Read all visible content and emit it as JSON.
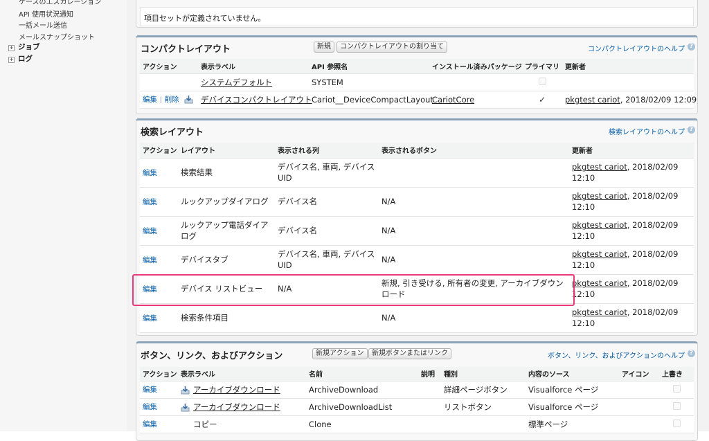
{
  "sidebar": {
    "items_top": [
      "ケースのエスカレーション",
      "API 使用状況通知",
      "一括メール送信",
      "メールスナップショット"
    ],
    "groups": [
      "ジョブ",
      "ログ"
    ],
    "toggle_glyph": "+"
  },
  "top_box": {
    "message": "項目セットが定義されていません。"
  },
  "compact": {
    "title": "コンパクトレイアウト",
    "btn_new": "新規",
    "btn_assign": "コンパクトレイアウトの割り当て",
    "help": "コンパクトレイアウトのヘルプ",
    "headers": [
      "アクション",
      "表示ラベル",
      "API 参照名",
      "インストール済みパッケージ",
      "プライマリ",
      "更新者"
    ],
    "rows": [
      {
        "action_edit": "",
        "action_sep": "",
        "action_delete": "",
        "label": "システムデフォルト",
        "api": "SYSTEM",
        "package": "",
        "primary": false,
        "modified_user": "",
        "modified_date": ""
      },
      {
        "action_edit": "編集",
        "action_sep": "|",
        "action_delete": "削除",
        "label": "デバイスコンパクトレイアウト",
        "api": "Cariot__DeviceCompactLayout",
        "package": "CariotCore",
        "primary": true,
        "check_glyph": "✓",
        "modified_user": "pkgtest cariot",
        "modified_date": ", 2018/02/09 12:09"
      }
    ]
  },
  "search": {
    "title": "検索レイアウト",
    "help": "検索レイアウトのヘルプ",
    "headers": [
      "アクション",
      "レイアウト",
      "表示される列",
      "表示されるボタン",
      "更新者"
    ],
    "rows": [
      {
        "action": "編集",
        "layout": "検索結果",
        "columns": "デバイス名, 車両, デバイスUID",
        "buttons": "",
        "modified_user": "pkgtest cariot",
        "modified_date": ", 2018/02/09 12:10"
      },
      {
        "action": "編集",
        "layout": "ルックアップダイアログ",
        "columns": "デバイス名",
        "buttons": "N/A",
        "modified_user": "pkgtest cariot",
        "modified_date": ", 2018/02/09 12:10"
      },
      {
        "action": "編集",
        "layout": "ルックアップ電話ダイアログ",
        "columns": "デバイス名",
        "buttons": "N/A",
        "modified_user": "pkgtest cariot",
        "modified_date": ", 2018/02/09 12:10"
      },
      {
        "action": "編集",
        "layout": "デバイスタブ",
        "columns": "デバイス名, 車両, デバイスUID",
        "buttons": "N/A",
        "modified_user": "pkgtest cariot",
        "modified_date": ", 2018/02/09 12:10"
      },
      {
        "action": "編集",
        "layout": "デバイス リストビュー",
        "columns": "N/A",
        "buttons": "新規, 引き受ける, 所有者の変更, アーカイブダウンロード",
        "modified_user": "pkgtest cariot",
        "modified_date": ", 2018/02/09 12:10"
      },
      {
        "action": "編集",
        "layout": "検索条件項目",
        "columns": "",
        "buttons": "N/A",
        "modified_user": "pkgtest cariot",
        "modified_date": ", 2018/02/09 12:10"
      }
    ]
  },
  "buttons_section": {
    "title": "ボタン、リンク、およびアクション",
    "btn_new_action": "新規アクション",
    "btn_new_button": "新規ボタンまたはリンク",
    "help": "ボタン、リンク、およびアクションのヘルプ",
    "headers": [
      "アクション",
      "表示ラベル",
      "名前",
      "説明",
      "種別",
      "内容のソース",
      "アイコン",
      "上書き"
    ],
    "rows": [
      {
        "action": "編集",
        "label": "アーカイブダウンロード",
        "has_icon": true,
        "name": "ArchiveDownload",
        "desc": "",
        "type": "詳細ページボタン",
        "source": "Visualforce ページ"
      },
      {
        "action": "編集",
        "label": "アーカイブダウンロード",
        "has_icon": true,
        "name": "ArchiveDownloadList",
        "desc": "",
        "type": "リストボタン",
        "source": "Visualforce ページ"
      },
      {
        "action": "編集",
        "label": "コピー",
        "has_icon": false,
        "name": "Clone",
        "desc": "",
        "type": "",
        "source": "標準ページ"
      }
    ]
  },
  "help_glyph": "?",
  "colors": {
    "link": "#015ba7",
    "panel_border": "#8aa3b9",
    "highlight": "#e83a7a"
  }
}
